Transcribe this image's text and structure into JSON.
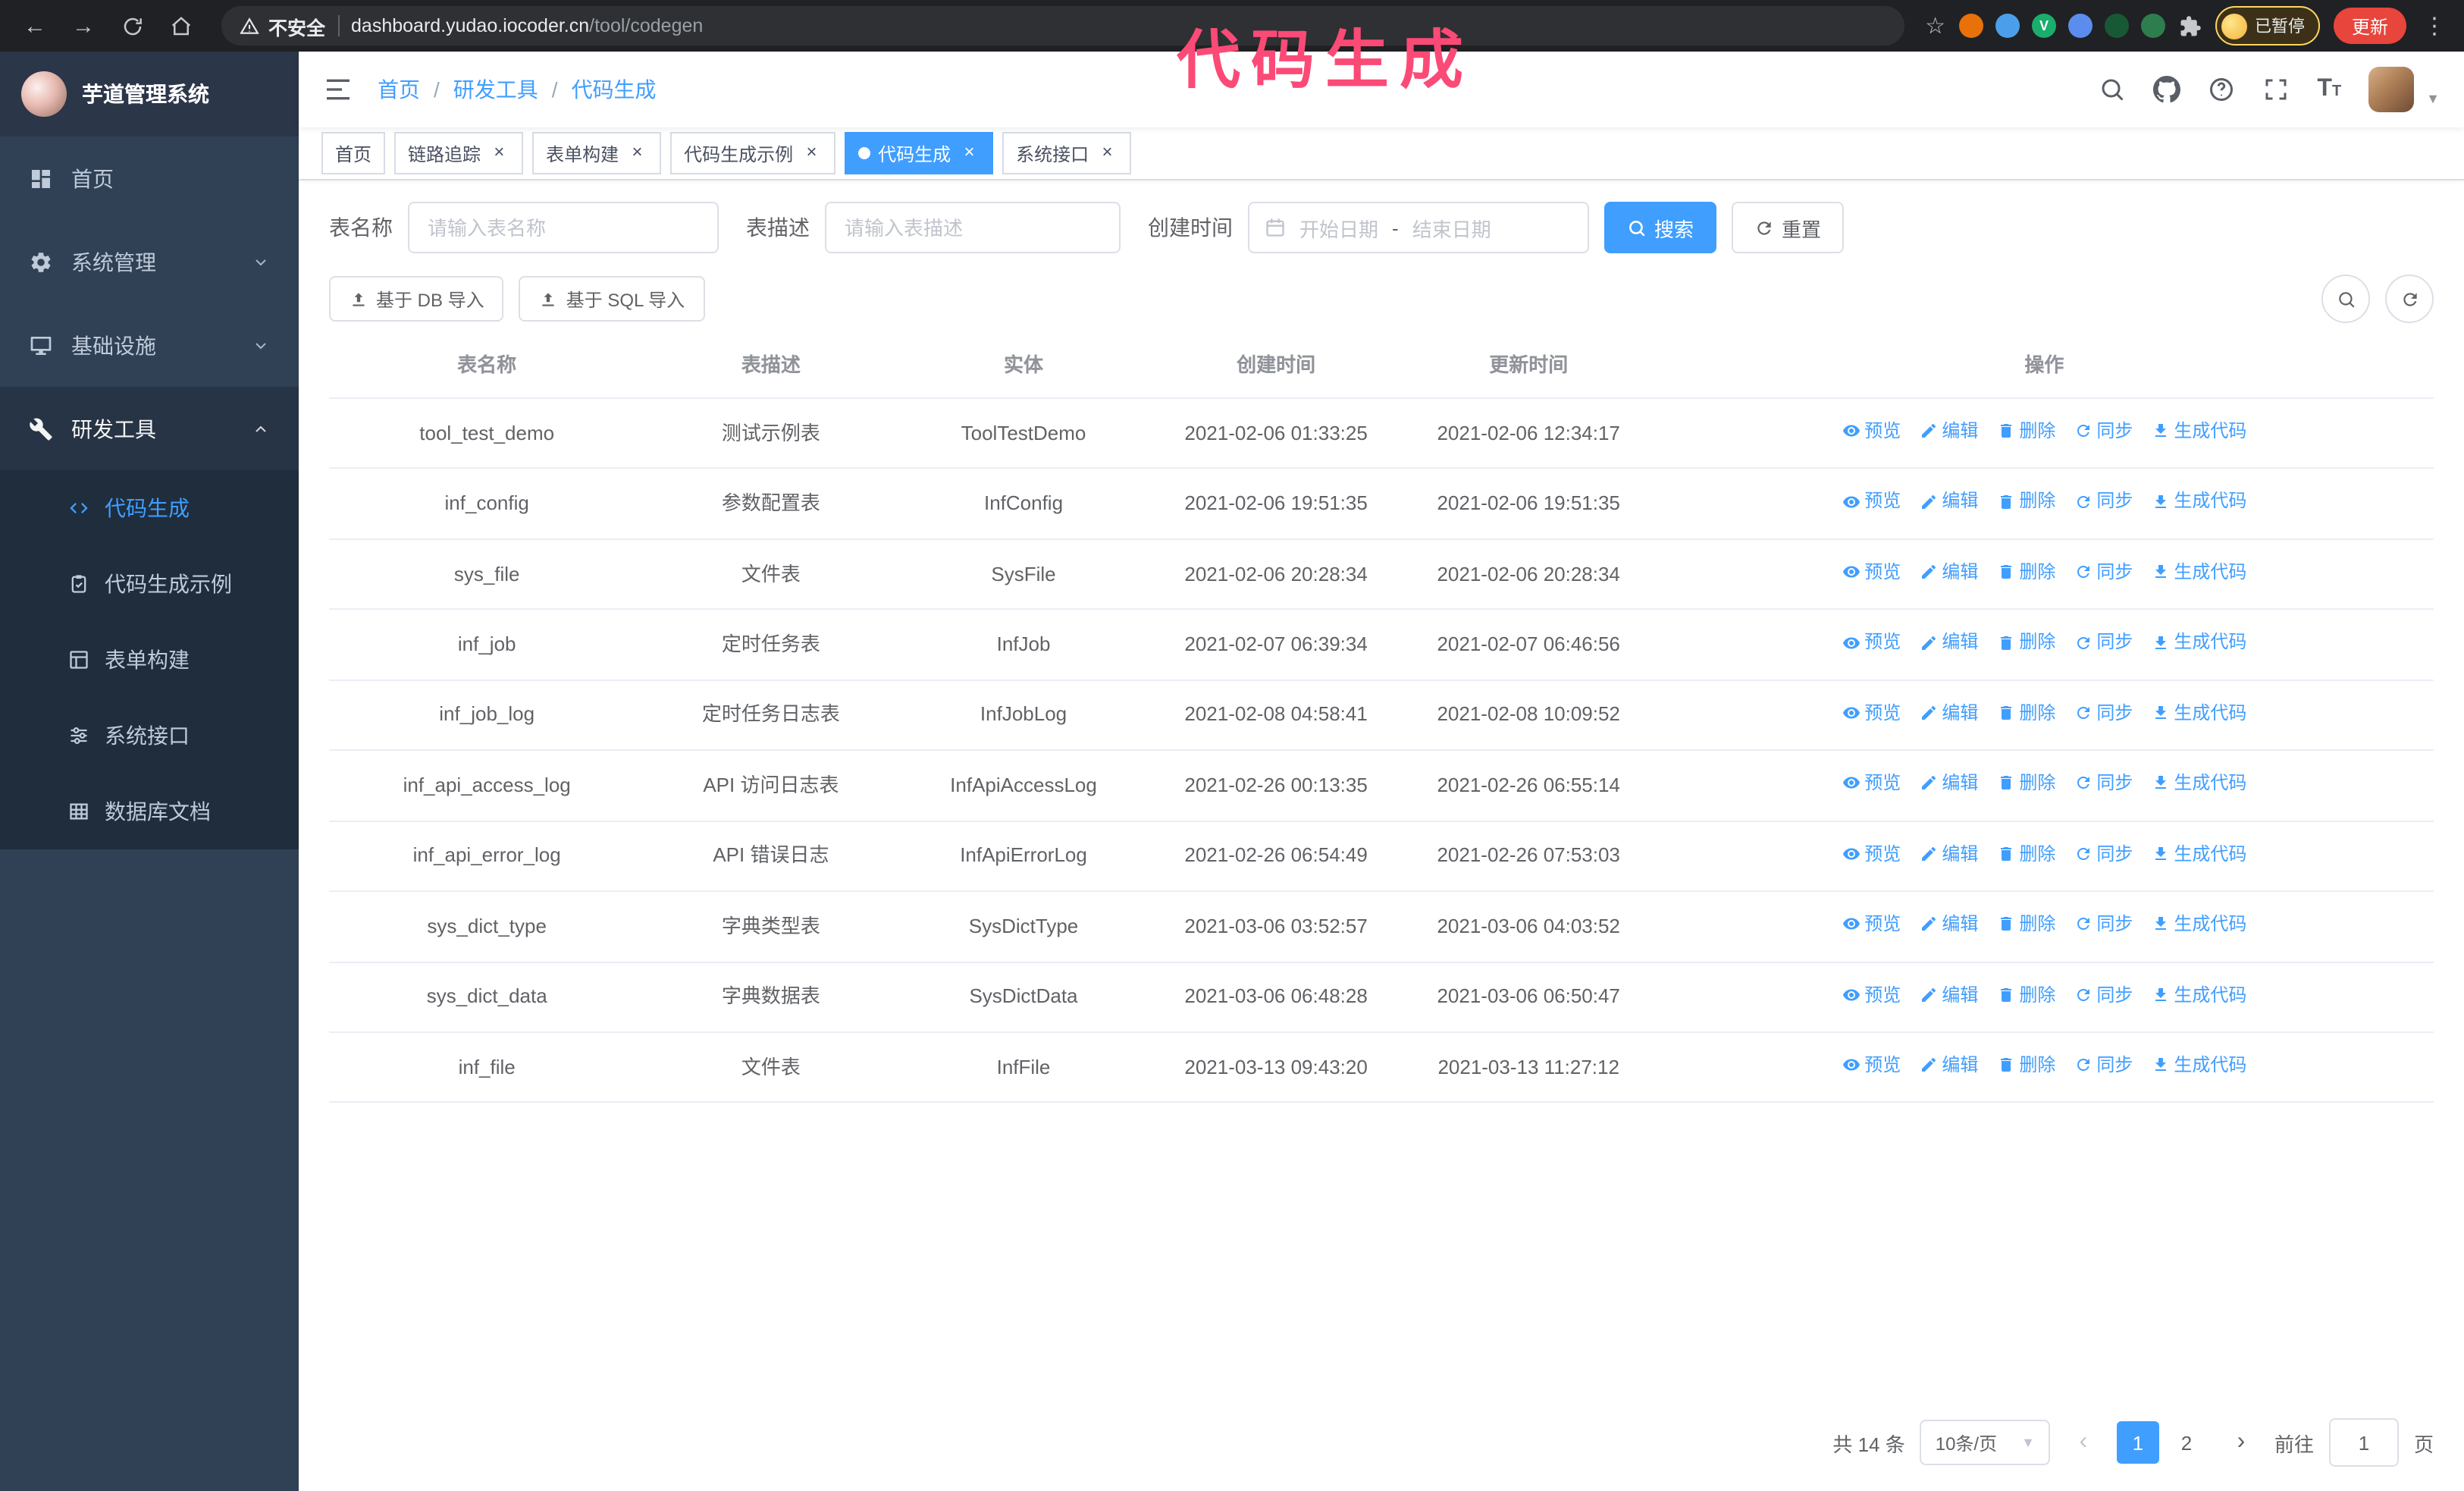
{
  "colors": {
    "accent": "#409eff",
    "sidebar": "#304156",
    "submenu": "#1f2d3d",
    "chrome": "#202124",
    "annotation": "#fb4a76",
    "update_button": "#e8453c"
  },
  "glyphs": {
    "back": "←",
    "forward": "→",
    "star": "☆",
    "menu_dots": "⋮",
    "close": "×",
    "prev": "‹",
    "next": "›",
    "caret_down": "▼"
  },
  "annotation": {
    "text": "代码生成"
  },
  "browser": {
    "security_label": "不安全",
    "url_domain": "dashboard.yudao.iocoder.cn",
    "url_path": "/tool/codegen",
    "profile_badge": "已暂停",
    "update_button": "更新",
    "extensions": [
      {
        "name": "extension-orange",
        "color": "#e8710a",
        "glyph": ""
      },
      {
        "name": "extension-blue-drop",
        "color": "#4b9fea",
        "glyph": ""
      },
      {
        "name": "extension-green-v",
        "color": "#1aad6c",
        "glyph": "V"
      },
      {
        "name": "extension-people",
        "color": "#5b8def",
        "glyph": ""
      },
      {
        "name": "extension-dark-green",
        "color": "#175935",
        "glyph": ""
      },
      {
        "name": "extension-leaf",
        "color": "#2e7d4f",
        "glyph": ""
      }
    ]
  },
  "sidebar": {
    "logo_title": "芋道管理系统",
    "items": [
      {
        "label": "首页"
      },
      {
        "label": "系统管理"
      },
      {
        "label": "基础设施"
      },
      {
        "label": "研发工具"
      }
    ],
    "submenu": [
      {
        "label": "代码生成"
      },
      {
        "label": "代码生成示例"
      },
      {
        "label": "表单构建"
      },
      {
        "label": "系统接口"
      },
      {
        "label": "数据库文档"
      }
    ]
  },
  "breadcrumb": {
    "items": [
      "首页",
      "研发工具",
      "代码生成"
    ],
    "separator": "/"
  },
  "tabs": [
    {
      "label": "首页",
      "closable": false,
      "active": false
    },
    {
      "label": "链路追踪",
      "closable": true,
      "active": false
    },
    {
      "label": "表单构建",
      "closable": true,
      "active": false
    },
    {
      "label": "代码生成示例",
      "closable": true,
      "active": false
    },
    {
      "label": "代码生成",
      "closable": true,
      "active": true
    },
    {
      "label": "系统接口",
      "closable": true,
      "active": false
    }
  ],
  "filters": {
    "table_name_label": "表名称",
    "table_name_placeholder": "请输入表名称",
    "table_desc_label": "表描述",
    "table_desc_placeholder": "请输入表描述",
    "create_time_label": "创建时间",
    "date_start_placeholder": "开始日期",
    "date_separator": "-",
    "date_end_placeholder": "结束日期",
    "search_button": "搜索",
    "reset_button": "重置"
  },
  "toolbar": {
    "import_db": "基于 DB 导入",
    "import_sql": "基于 SQL 导入"
  },
  "table": {
    "columns": [
      "表名称",
      "表描述",
      "实体",
      "创建时间",
      "更新时间",
      "操作"
    ],
    "action_labels": [
      "预览",
      "编辑",
      "删除",
      "同步",
      "生成代码"
    ],
    "rows": [
      {
        "name": "tool_test_demo",
        "desc": "测试示例表",
        "entity": "ToolTestDemo",
        "created": "2021-02-06 01:33:25",
        "updated": "2021-02-06 12:34:17"
      },
      {
        "name": "inf_config",
        "desc": "参数配置表",
        "entity": "InfConfig",
        "created": "2021-02-06 19:51:35",
        "updated": "2021-02-06 19:51:35"
      },
      {
        "name": "sys_file",
        "desc": "文件表",
        "entity": "SysFile",
        "created": "2021-02-06 20:28:34",
        "updated": "2021-02-06 20:28:34"
      },
      {
        "name": "inf_job",
        "desc": "定时任务表",
        "entity": "InfJob",
        "created": "2021-02-07 06:39:34",
        "updated": "2021-02-07 06:46:56"
      },
      {
        "name": "inf_job_log",
        "desc": "定时任务日志表",
        "entity": "InfJobLog",
        "created": "2021-02-08 04:58:41",
        "updated": "2021-02-08 10:09:52"
      },
      {
        "name": "inf_api_access_log",
        "desc": "API 访问日志表",
        "entity": "InfApiAccessLog",
        "created": "2021-02-26 00:13:35",
        "updated": "2021-02-26 06:55:14"
      },
      {
        "name": "inf_api_error_log",
        "desc": "API 错误日志",
        "entity": "InfApiErrorLog",
        "created": "2021-02-26 06:54:49",
        "updated": "2021-02-26 07:53:03"
      },
      {
        "name": "sys_dict_type",
        "desc": "字典类型表",
        "entity": "SysDictType",
        "created": "2021-03-06 03:52:57",
        "updated": "2021-03-06 04:03:52"
      },
      {
        "name": "sys_dict_data",
        "desc": "字典数据表",
        "entity": "SysDictData",
        "created": "2021-03-06 06:48:28",
        "updated": "2021-03-06 06:50:47"
      },
      {
        "name": "inf_file",
        "desc": "文件表",
        "entity": "InfFile",
        "created": "2021-03-13 09:43:20",
        "updated": "2021-03-13 11:27:12"
      }
    ]
  },
  "pagination": {
    "total": "共 14 条",
    "page_size": "10条/页",
    "pages": [
      "1",
      "2"
    ],
    "active_page": "1",
    "goto_label": "前往",
    "goto_value": "1",
    "goto_suffix": "页"
  }
}
